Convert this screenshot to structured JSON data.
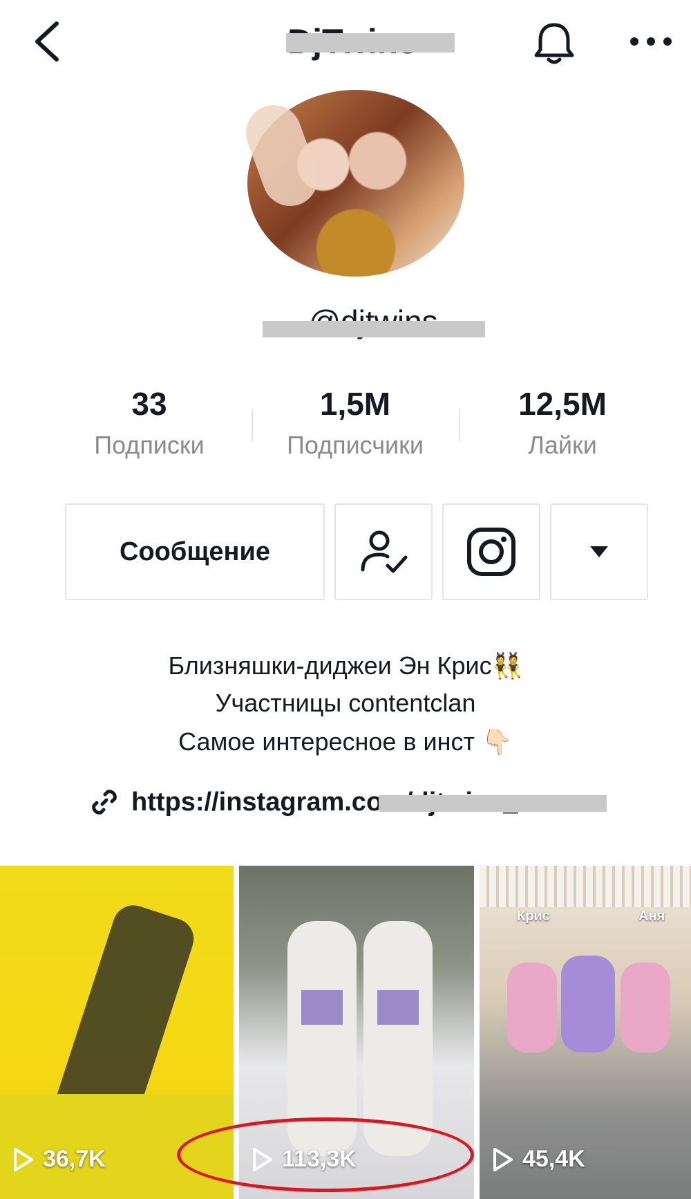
{
  "header": {
    "title": "DjTwins",
    "back_icon": "chevron-left-icon",
    "notification_icon": "bell-icon",
    "more_icon": "more-horizontal-icon"
  },
  "profile": {
    "username": "@djtwins"
  },
  "stats": [
    {
      "value": "33",
      "label": "Подписки"
    },
    {
      "value": "1,5M",
      "label": "Подписчики"
    },
    {
      "value": "12,5M",
      "label": "Лайки"
    }
  ],
  "actions": {
    "message_label": "Сообщение",
    "following_icon": "user-check-icon",
    "instagram_icon": "instagram-icon",
    "dropdown_icon": "caret-down-icon"
  },
  "bio": {
    "line1": "Близняшки-диджеи Эн Крис👯",
    "line2": "Участницы contentclan",
    "line3": "Самое интересное в инст 👇🏻",
    "link": "https://instagram.com/djtwins_a"
  },
  "videos": [
    {
      "views": "36,7K",
      "caption_left": "",
      "caption_right": ""
    },
    {
      "views": "113,3K",
      "caption_left": "",
      "caption_right": ""
    },
    {
      "views": "45,4K",
      "caption_left": "Крис",
      "caption_right": "Аня"
    }
  ],
  "colors": {
    "text": "#161823",
    "muted": "#8a8b91",
    "border": "#e3e3e4",
    "annotation_red": "#e1141c"
  }
}
